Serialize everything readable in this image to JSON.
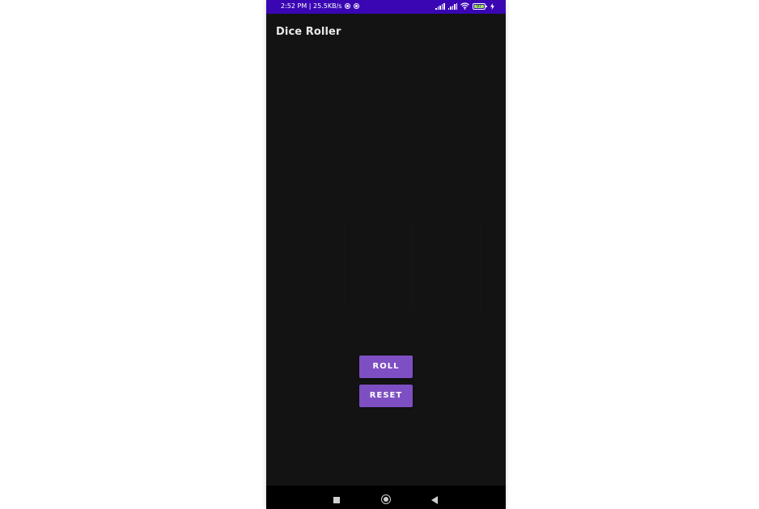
{
  "status_bar": {
    "time_speed": "2:52 PM | 25.5KB/s",
    "battery_level": "97",
    "icons": [
      "app-notification-icon",
      "app-notification-icon",
      "signal-icon",
      "signal-icon",
      "wifi-icon",
      "battery-icon",
      "charging-icon"
    ]
  },
  "app_bar": {
    "title": "Dice Roller"
  },
  "buttons": {
    "roll_label": "ROLL",
    "reset_label": "RESET"
  },
  "nav_bar": {
    "icons": [
      "recents-icon",
      "home-icon",
      "back-icon"
    ]
  },
  "colors": {
    "status_bar": "#3a06b4",
    "background": "#121312",
    "button": "#7e4fc2",
    "button_text": "#ffffff",
    "nav_bar": "#000000"
  }
}
